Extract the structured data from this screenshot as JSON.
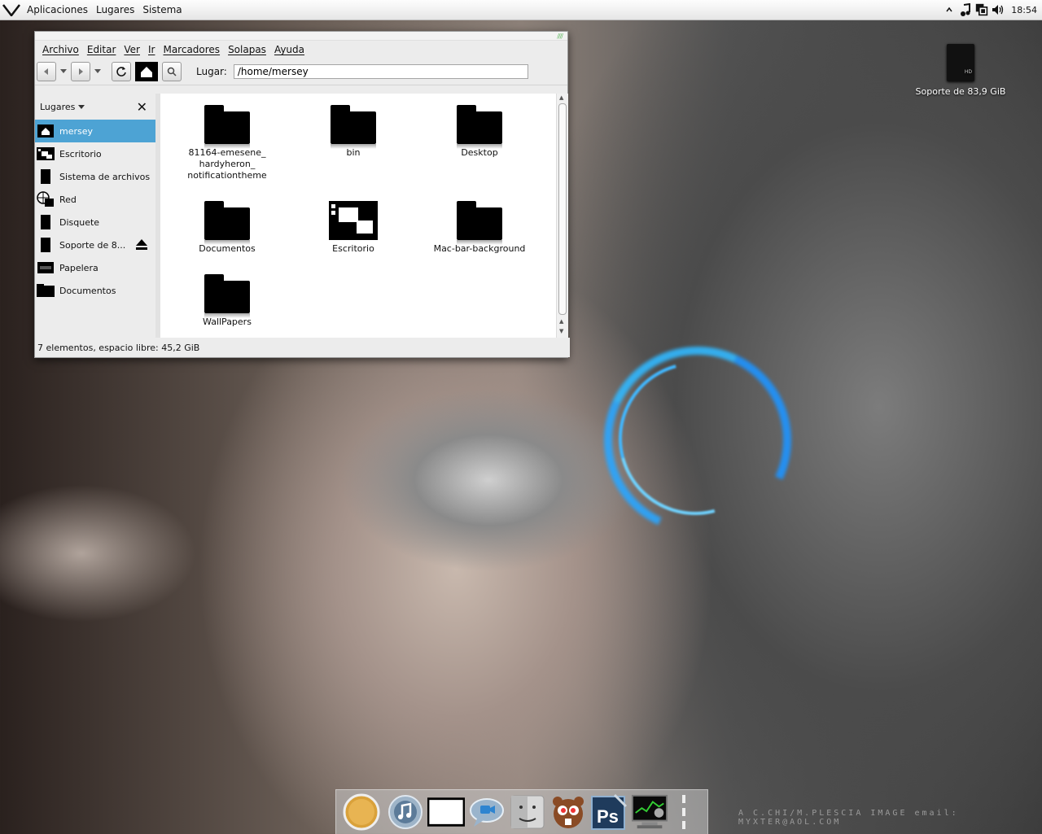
{
  "top_panel": {
    "menus": [
      "Aplicaciones",
      "Lugares",
      "Sistema"
    ],
    "clock": "18:54"
  },
  "window": {
    "menubar": [
      "Archivo",
      "Editar",
      "Ver",
      "Ir",
      "Marcadores",
      "Solapas",
      "Ayuda"
    ],
    "toolbar": {
      "location_label": "Lugar:",
      "location_value": "/home/mersey"
    },
    "sidebar": {
      "header": "Lugares",
      "items": [
        {
          "label": "mersey",
          "icon": "home-icon",
          "selected": true
        },
        {
          "label": "Escritorio",
          "icon": "desktop-icon"
        },
        {
          "label": "Sistema de archivos",
          "icon": "drive-icon"
        },
        {
          "label": "Red",
          "icon": "network-icon"
        },
        {
          "label": "Disquete",
          "icon": "floppy-icon"
        },
        {
          "label": "Soporte de 8...",
          "icon": "drive-icon"
        },
        {
          "label": "Papelera",
          "icon": "trash-icon"
        },
        {
          "label": "Documentos",
          "icon": "folder-icon"
        }
      ]
    },
    "files": [
      {
        "name": "81164-emesene_\nhardyheron_\nnotificationtheme",
        "type": "folder"
      },
      {
        "name": "bin",
        "type": "folder"
      },
      {
        "name": "Desktop",
        "type": "folder"
      },
      {
        "name": "Documentos",
        "type": "folder"
      },
      {
        "name": "Escritorio",
        "type": "desktop"
      },
      {
        "name": "Mac-bar-background",
        "type": "folder"
      },
      {
        "name": "WallPapers",
        "type": "folder"
      }
    ],
    "status": "7 elementos, espacio libre: 45,2 GiB"
  },
  "desktop": {
    "hd_label": "Soporte de 83,9 GiB",
    "hd_badge": "HD",
    "credit": "A C.CHI/M.PLESCIA IMAGE email: MYXTER@AOL.COM"
  },
  "dock": {
    "items": [
      "safari-icon",
      "itunes-icon",
      "terminal-icon",
      "ichat-icon",
      "finder-icon",
      "beaver-icon",
      "photoshop-icon",
      "system-monitor-icon"
    ]
  }
}
